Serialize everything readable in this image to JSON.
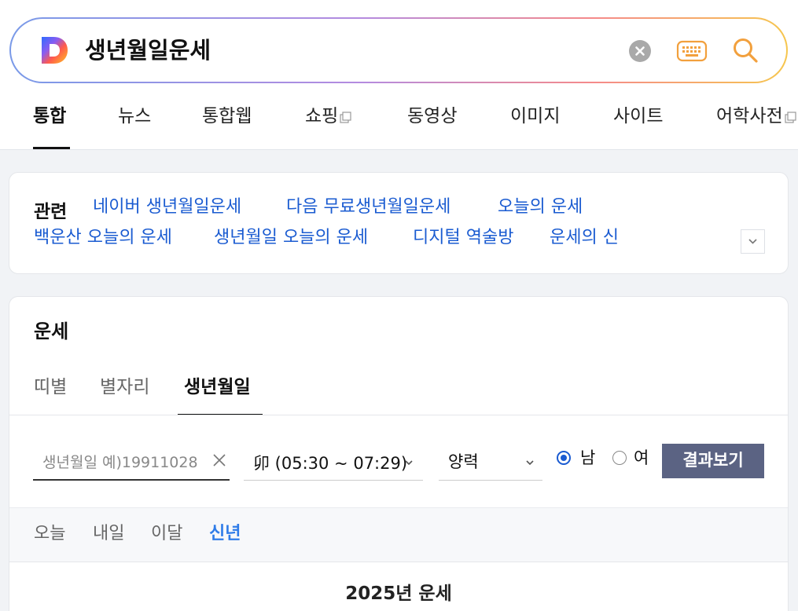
{
  "search": {
    "query": "생년월일운세",
    "logo_icon": "daum-d-logo",
    "clear_icon": "clear-x-icon",
    "keyboard_icon": "keyboard-icon",
    "search_icon": "search-icon"
  },
  "tabs": [
    {
      "label": "통합",
      "active": true
    },
    {
      "label": "뉴스"
    },
    {
      "label": "통합웹"
    },
    {
      "label": "쇼핑",
      "external": true
    },
    {
      "label": "동영상"
    },
    {
      "label": "이미지"
    },
    {
      "label": "사이트"
    },
    {
      "label": "어학사전",
      "external": true
    }
  ],
  "related": {
    "title": "관련",
    "links": [
      "네이버 생년월일운세",
      "다음 무료생년월일운세",
      "오늘의 운세",
      "백운산 오늘의 운세",
      "생년월일 오늘의 운세",
      "디지털 역술방",
      "운세의 신"
    ]
  },
  "fortune": {
    "title": "운세",
    "tabs": [
      "띠별",
      "별자리",
      "생년월일"
    ],
    "active_tab": "생년월일",
    "birth_placeholder": "생년월일 예)19911028",
    "time_value": "卯 (05:30 ~ 07:29)",
    "calendar_value": "양력",
    "gender_male": "남",
    "gender_female": "여",
    "gender_selected": "남",
    "result_button": "결과보기",
    "periods": [
      "오늘",
      "내일",
      "이달",
      "신년"
    ],
    "active_period": "신년",
    "year_title": "2025년 운세"
  },
  "colors": {
    "link": "#1a5bd1",
    "active_period": "#2f7ce8",
    "button": "#5b6383"
  }
}
